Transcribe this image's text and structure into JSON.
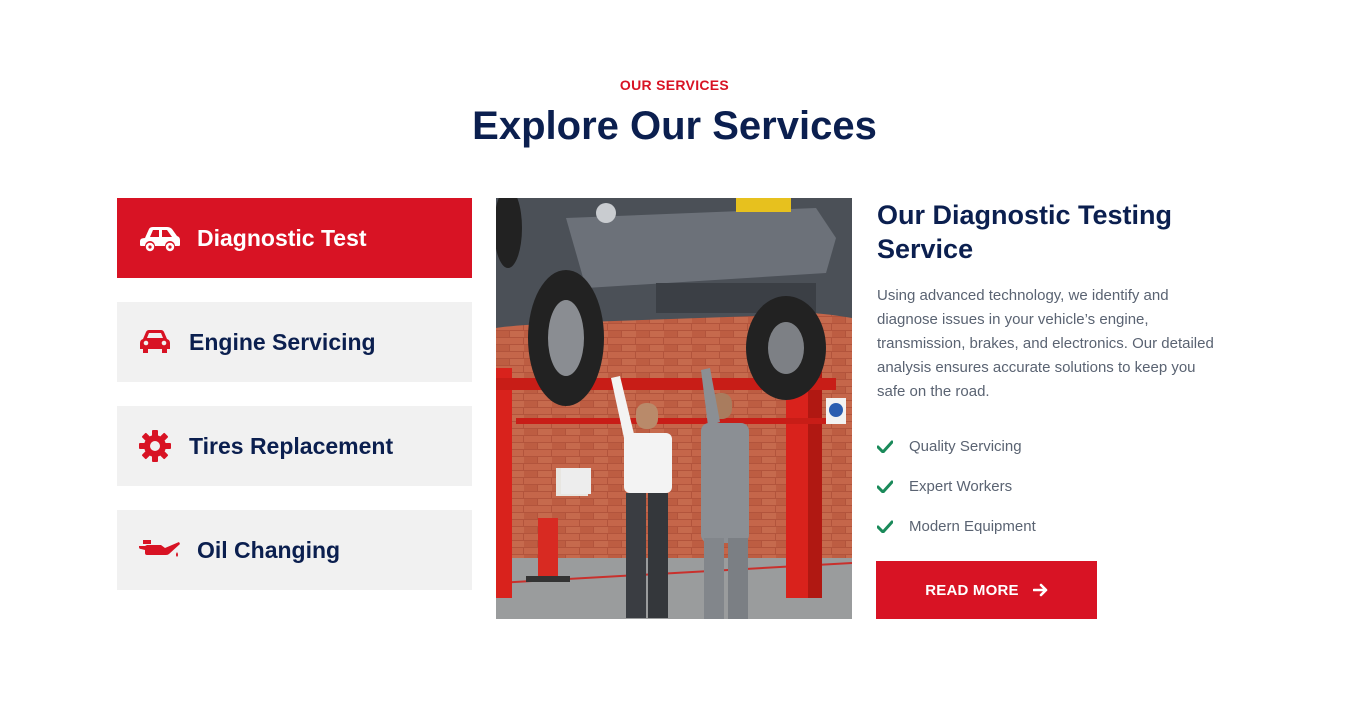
{
  "header": {
    "eyebrow": "OUR SERVICES",
    "title": "Explore Our Services"
  },
  "tabs": [
    {
      "label": "Diagnostic Test",
      "icon": "car-side-icon",
      "active": true
    },
    {
      "label": "Engine Servicing",
      "icon": "car-front-icon",
      "active": false
    },
    {
      "label": "Tires Replacement",
      "icon": "cog-icon",
      "active": false
    },
    {
      "label": "Oil Changing",
      "icon": "oil-can-icon",
      "active": false
    }
  ],
  "detail": {
    "title": "Our Diagnostic Testing Service",
    "text": "Using advanced technology, we identify and diagnose issues in your vehicle’s engine, transmission, brakes, and electronics. Our detailed analysis ensures accurate solutions to keep you safe on the road.",
    "features": [
      "Quality Servicing",
      "Expert Workers",
      "Modern Equipment"
    ],
    "button_label": "READ MORE"
  },
  "colors": {
    "accent": "#d81324",
    "navy": "#0b1f4f",
    "check": "#1a8a5a",
    "tab_bg": "#f1f1f1"
  }
}
